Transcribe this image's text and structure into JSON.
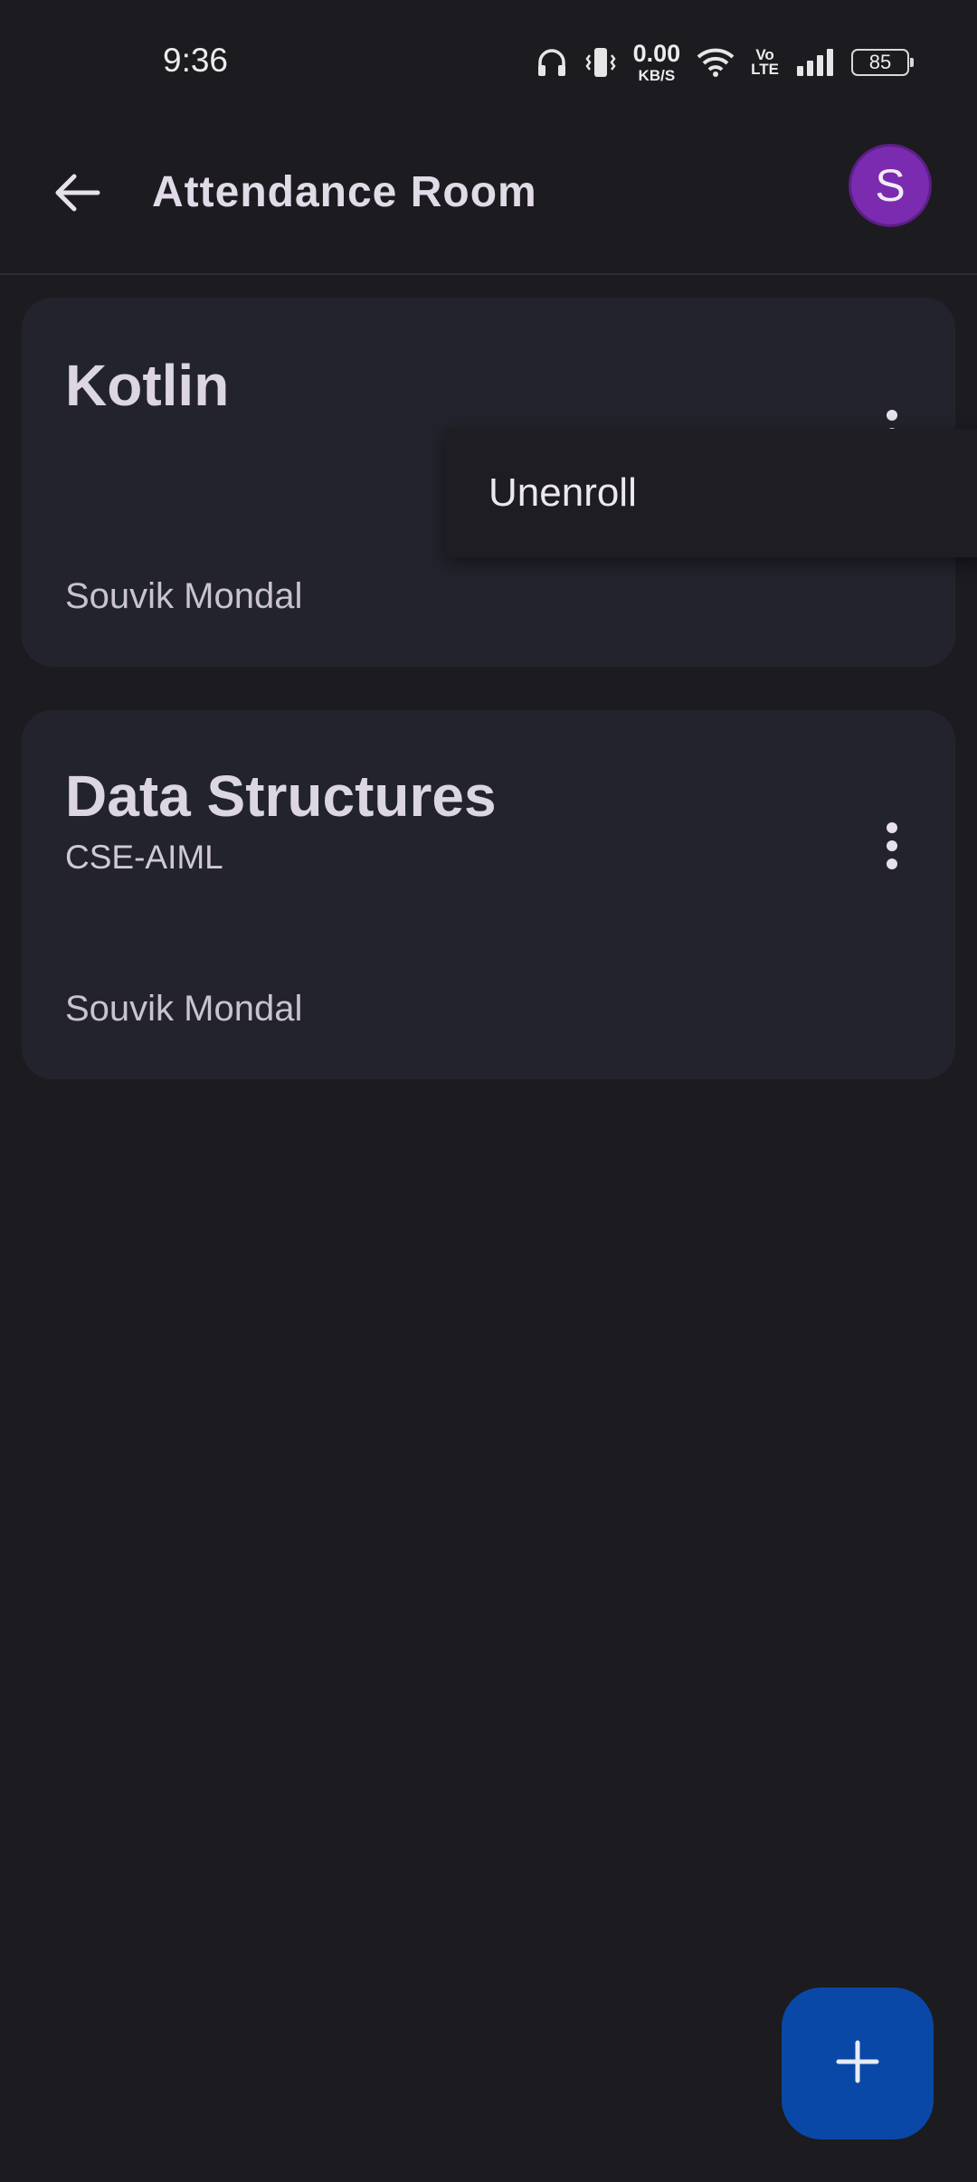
{
  "status_bar": {
    "time": "9:36",
    "net_speed_value": "0.00",
    "net_speed_unit": "KB/S",
    "volte_top": "Vo",
    "volte_bottom": "LTE",
    "battery": "85"
  },
  "app_bar": {
    "title": "Attendance Room",
    "avatar_letter": "S",
    "back_icon": "arrow-back-icon"
  },
  "classes": [
    {
      "title": "Kotlin",
      "subtitle": "",
      "teacher": "Souvik Mondal"
    },
    {
      "title": "Data Structures",
      "subtitle": "CSE-AIML",
      "teacher": "Souvik Mondal"
    }
  ],
  "menu": {
    "items": [
      "Unenroll"
    ]
  },
  "fab": {
    "icon": "plus-icon"
  },
  "colors": {
    "background": "#1c1b20",
    "card": "#23232d",
    "avatar": "#7a2bb0",
    "fab": "#0a48a8"
  }
}
